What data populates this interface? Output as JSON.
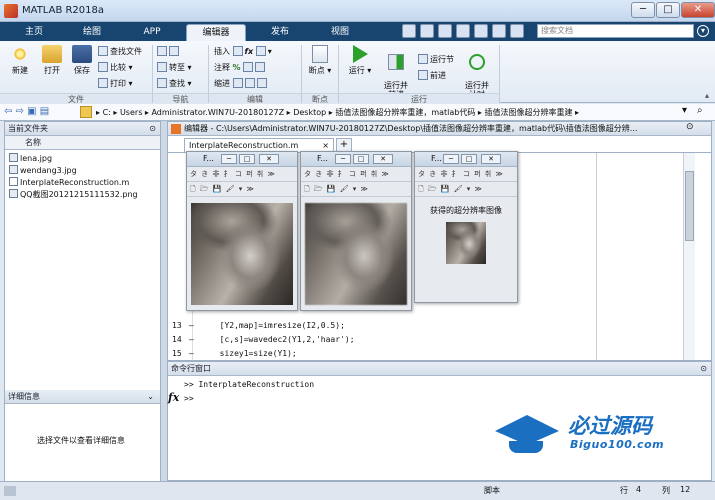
{
  "window": {
    "title": "MATLAB R2018a",
    "min": "─",
    "max": "□",
    "close": "✕"
  },
  "tabs": [
    {
      "label": "主页"
    },
    {
      "label": "绘图"
    },
    {
      "label": "APP"
    },
    {
      "label": "编辑器"
    },
    {
      "label": "发布"
    },
    {
      "label": "视图"
    }
  ],
  "search": {
    "placeholder": "搜索文档"
  },
  "ribbon": {
    "file": {
      "new": "新建",
      "open": "打开",
      "save": "保存",
      "find_files": "查找文件",
      "compare": "比较",
      "print": "打印",
      "label": "文件"
    },
    "nav": {
      "goto": "转至",
      "find": "查找",
      "label": "导航"
    },
    "edit": {
      "insert": "插入",
      "comment": "注释",
      "indent": "缩进",
      "label": "编辑"
    },
    "breakpoints": {
      "bp": "断点",
      "label": "断点"
    },
    "run": {
      "run": "运行",
      "run_advance": "运行并\n前进",
      "run_section": "运行节",
      "advance": "前进",
      "run_time": "运行并\n计时",
      "label": "运行"
    }
  },
  "address": {
    "crumbs": [
      "C:",
      "Users",
      "Administrator.WIN7U-20180127Z",
      "Desktop",
      "插值法图像超分辨率重建，matlab代码",
      "插值法图像超分辨率重建"
    ]
  },
  "current_folder": {
    "title": "当前文件夹",
    "col_name": "名称",
    "files": [
      "lena.jpg",
      "wendang3.jpg",
      "InterplateReconstruction.m",
      "QQ截图20121215111532.png"
    ]
  },
  "details": {
    "title": "详细信息",
    "hint": "选择文件以查看详细信息"
  },
  "editor": {
    "title": "编辑器 - C:\\Users\\Administrator.WIN7U-20180127Z\\Desktop\\插值法图像超分辨率重建，matlab代码\\插值法图像超分辨...",
    "tab": "InterplateReconstruction.m",
    "tab_close": "×",
    "add_tab": "+",
    "lines": [
      {
        "num": "13",
        "dash": "–",
        "code": "[Y2,map]=imresize(I2,0.5);"
      },
      {
        "num": "14",
        "dash": "–",
        "code": "[c,s]=wavedec2(Y1,2,'haar');"
      },
      {
        "num": "15",
        "dash": "–",
        "code": "sizey1=size(Y1);"
      }
    ]
  },
  "figures": [
    {
      "title": "F...",
      "toolbar1": "タ き 非 扌 コ 퍼 취 ≫",
      "toolbar2": "🗋 🗁 💾 🖌 ▾ ≫",
      "caption": ""
    },
    {
      "title": "F...",
      "toolbar1": "タ き 非 扌 コ 퍼 취 ≫",
      "toolbar2": "🗋 🗁 💾 🖌 ▾ ≫",
      "caption": ""
    },
    {
      "title": "F...",
      "toolbar1": "タ き 非 扌 コ 퍼 취 ≫",
      "toolbar2": "🗋 🗁 💾 🖌 ▾ ≫",
      "caption": "获得的超分辨率图像"
    }
  ],
  "command_window": {
    "title": "命令行窗口",
    "line1": ">> InterplateReconstruction",
    "prompt": ">>",
    "fx": "fx"
  },
  "watermark": {
    "main": "必过源码",
    "sub": "Biguo100.com"
  },
  "status": {
    "script": "脚本",
    "row_label": "行",
    "row": "4",
    "col_label": "列",
    "col": "12"
  },
  "colors": {
    "accent_tab": "#17456f",
    "ribbon_bg": "#e2eaf4",
    "watermark": "#1a6fc1"
  }
}
